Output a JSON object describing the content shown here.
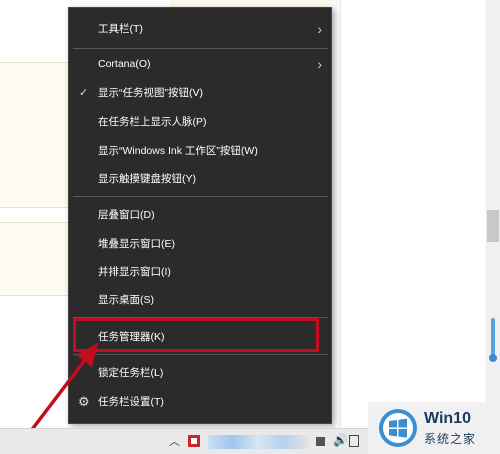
{
  "context_menu": {
    "items": [
      {
        "label": "工具栏(T)",
        "submenu": true
      },
      {
        "label": "Cortana(O)",
        "submenu": true
      },
      {
        "label": "显示“任务视图”按钮(V)",
        "checked": true
      },
      {
        "label": "在任务栏上显示人脉(P)"
      },
      {
        "label": "显示“Windows Ink 工作区”按钮(W)"
      },
      {
        "label": "显示触摸键盘按钮(Y)"
      },
      {
        "label": "层叠窗口(D)"
      },
      {
        "label": "堆叠显示窗口(E)"
      },
      {
        "label": "并排显示窗口(I)"
      },
      {
        "label": "显示桌面(S)"
      },
      {
        "label": "任务管理器(K)",
        "highlighted": true
      },
      {
        "label": "锁定任务栏(L)"
      },
      {
        "label": "任务栏设置(T)",
        "icon": "gear-icon"
      }
    ]
  },
  "icons": {
    "submenu": "chevron-right-icon",
    "check": "checkmark-icon",
    "settings": "gear-icon",
    "tray_expand": "chevron-up-icon",
    "volume": "speaker-icon"
  },
  "watermark": {
    "title": "Win10",
    "subtitle": "系统之家"
  },
  "colors": {
    "menu_bg": "#2b2b2b",
    "menu_text": "#ffffff",
    "annotation_red": "#c10d1c",
    "taskbar_bg": "#e9e9e9"
  }
}
